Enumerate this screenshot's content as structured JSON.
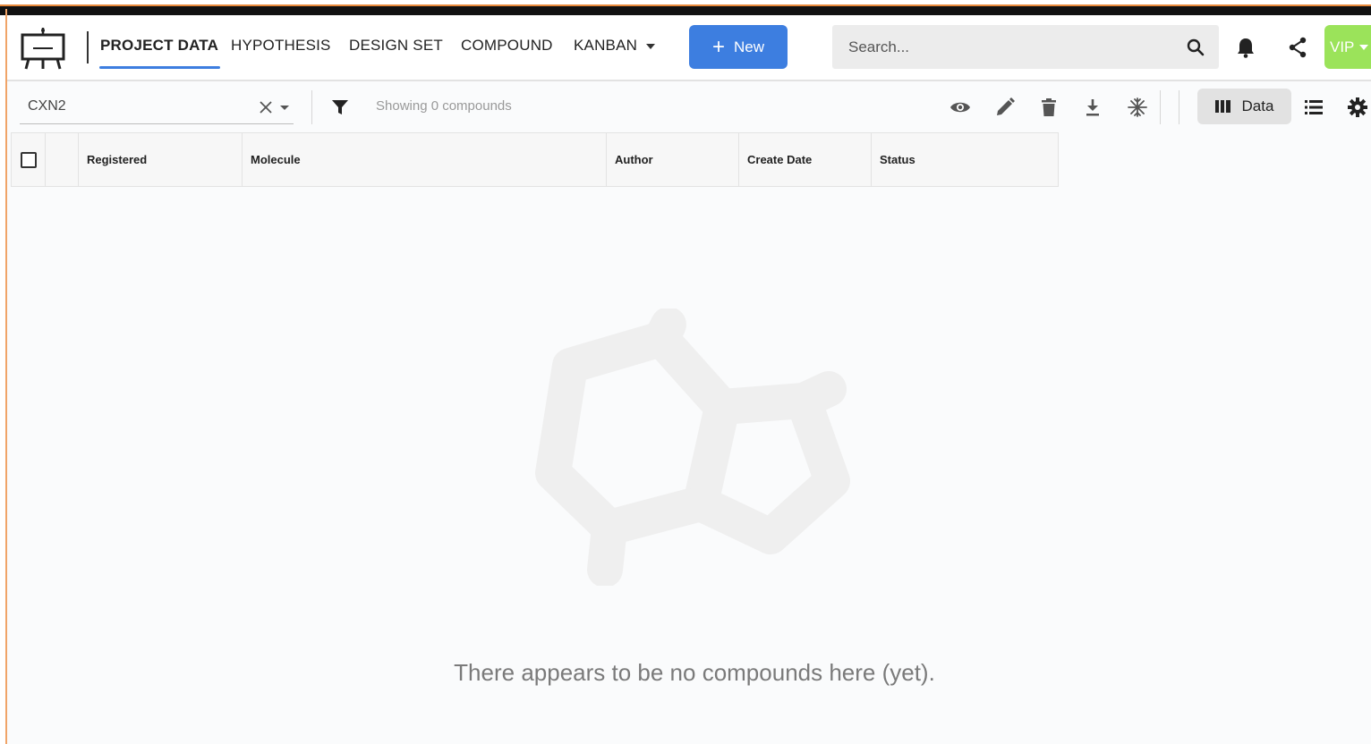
{
  "header": {
    "nav": [
      {
        "label": "PROJECT DATA",
        "active": true
      },
      {
        "label": "HYPOTHESIS",
        "active": false
      },
      {
        "label": "DESIGN SET",
        "active": false
      },
      {
        "label": "COMPOUND",
        "active": false
      },
      {
        "label": "KANBAN",
        "active": false,
        "has_dropdown": true
      }
    ],
    "new_button_label": "New",
    "search_placeholder": "Search...",
    "user_badge": "VIP",
    "icons": [
      "easel-logo-icon",
      "search-icon",
      "bell-icon",
      "share-icon",
      "chevron-down-icon"
    ]
  },
  "toolbar": {
    "project_value": "CXN2",
    "showing_text": "Showing 0 compounds",
    "data_button_label": "Data",
    "icons": [
      "filter-icon",
      "eye-icon",
      "pencil-icon",
      "trash-icon",
      "download-icon",
      "snowflake-icon",
      "columns-icon",
      "list-icon",
      "gear-icon"
    ]
  },
  "table": {
    "columns": [
      "Registered",
      "Molecule",
      "Author",
      "Create Date",
      "Status"
    ],
    "rows": []
  },
  "empty_state": {
    "message": "There appears to be no compounds here (yet).",
    "icon": "molecule-illustration"
  },
  "colors": {
    "accent": "#3d7ee0",
    "vip": "#9be35a",
    "illustration": "#efefef"
  }
}
